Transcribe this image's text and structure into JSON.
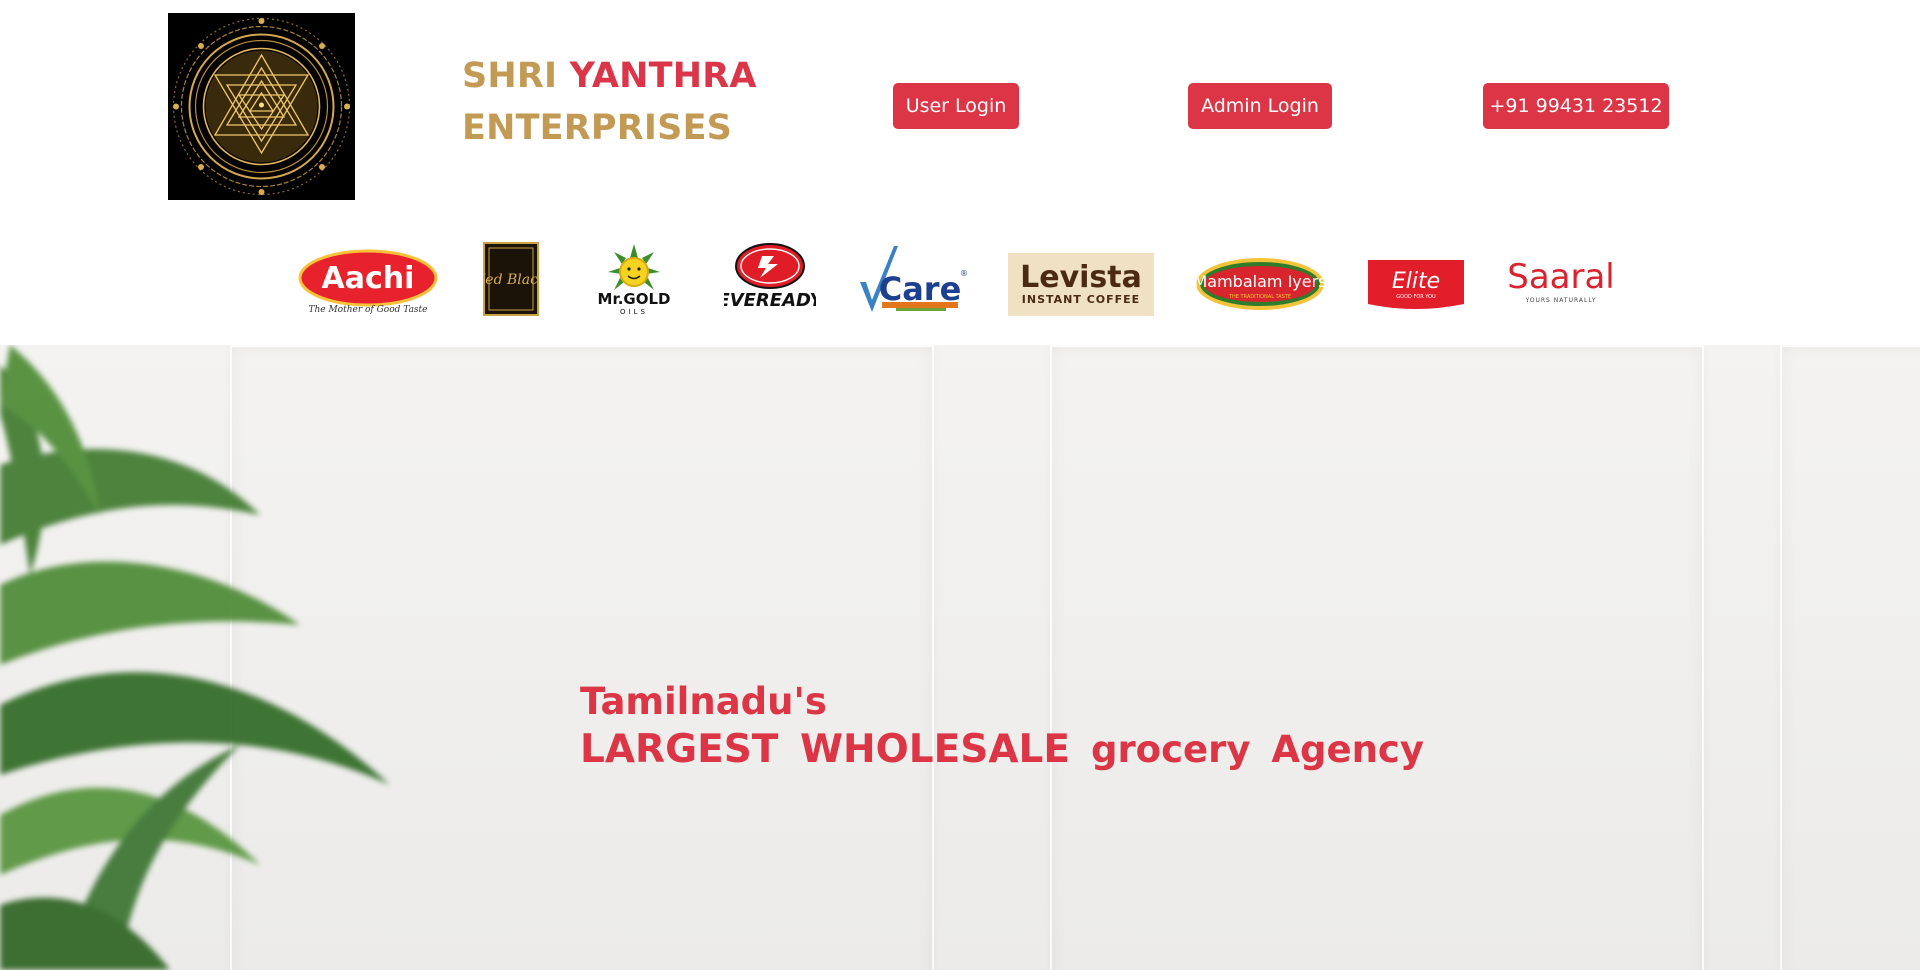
{
  "site": {
    "brand_word1": "SHRI",
    "brand_word2": "YANTHRA",
    "brand_word3": "ENTERPRISES"
  },
  "header": {
    "user_login": "User Login",
    "admin_login": "Admin Login",
    "phone": "+91 99431 23512"
  },
  "brands": [
    {
      "name": "Aachi",
      "tagline": "The Mother of Good Taste"
    },
    {
      "name": "Zed Black"
    },
    {
      "name": "Mr.GOLD",
      "tagline": "OILS"
    },
    {
      "name": "EVEREADY"
    },
    {
      "name": "Care"
    },
    {
      "name": "Levista",
      "tagline": "INSTANT COFFEE"
    },
    {
      "name": "Mambalam Iyers",
      "tagline": "THE TRADITIONAL TASTE"
    },
    {
      "name": "Elite",
      "tagline": "GOOD FOR YOU"
    },
    {
      "name": "Saaral",
      "tagline": "YOURS NATURALLY"
    }
  ],
  "hero": {
    "line1": "Tamilnadu's",
    "line2_bold": "LARGEST WHOLESALE",
    "line2_rest": "grocery Agency"
  },
  "colors": {
    "accent_red": "#dc3545",
    "brand_gold": "#c39a53"
  }
}
